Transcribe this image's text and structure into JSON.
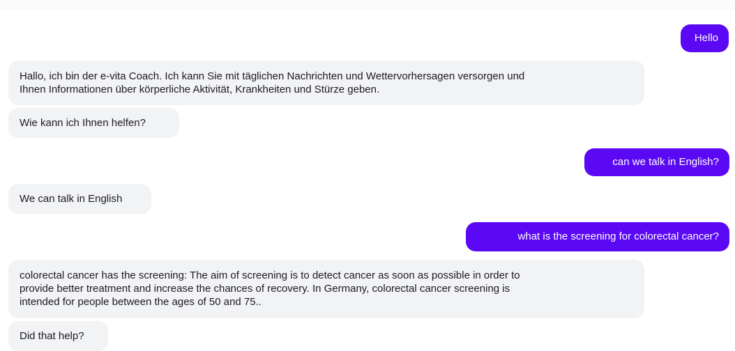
{
  "messages": [
    {
      "role": "user",
      "lines": [
        "Hello"
      ]
    },
    {
      "role": "bot",
      "lines": [
        "Hallo, ich bin der e-vita Coach. Ich kann Sie mit täglichen Nachrichten und Wettervorhersagen versorgen und",
        "Ihnen Informationen über körperliche Aktivität, Krankheiten und Stürze geben."
      ]
    },
    {
      "role": "bot",
      "lines": [
        "Wie kann ich Ihnen helfen?"
      ]
    },
    {
      "role": "user",
      "lines": [
        "can we talk in English?"
      ]
    },
    {
      "role": "bot",
      "lines": [
        "We can talk in English"
      ]
    },
    {
      "role": "user",
      "lines": [
        "what is the screening for colorectal cancer?"
      ]
    },
    {
      "role": "bot",
      "lines": [
        "colorectal cancer has the screening: The aim of screening is to detect cancer as soon as possible in order to",
        "provide better treatment and increase the chances of recovery. In Germany, colorectal cancer screening is",
        "intended for people between the ages of 50 and 75.."
      ]
    },
    {
      "role": "bot",
      "lines": [
        "Did that help?"
      ]
    }
  ],
  "colors": {
    "user_bubble": "#5b08f5",
    "bot_bubble": "#f2f3f5"
  }
}
